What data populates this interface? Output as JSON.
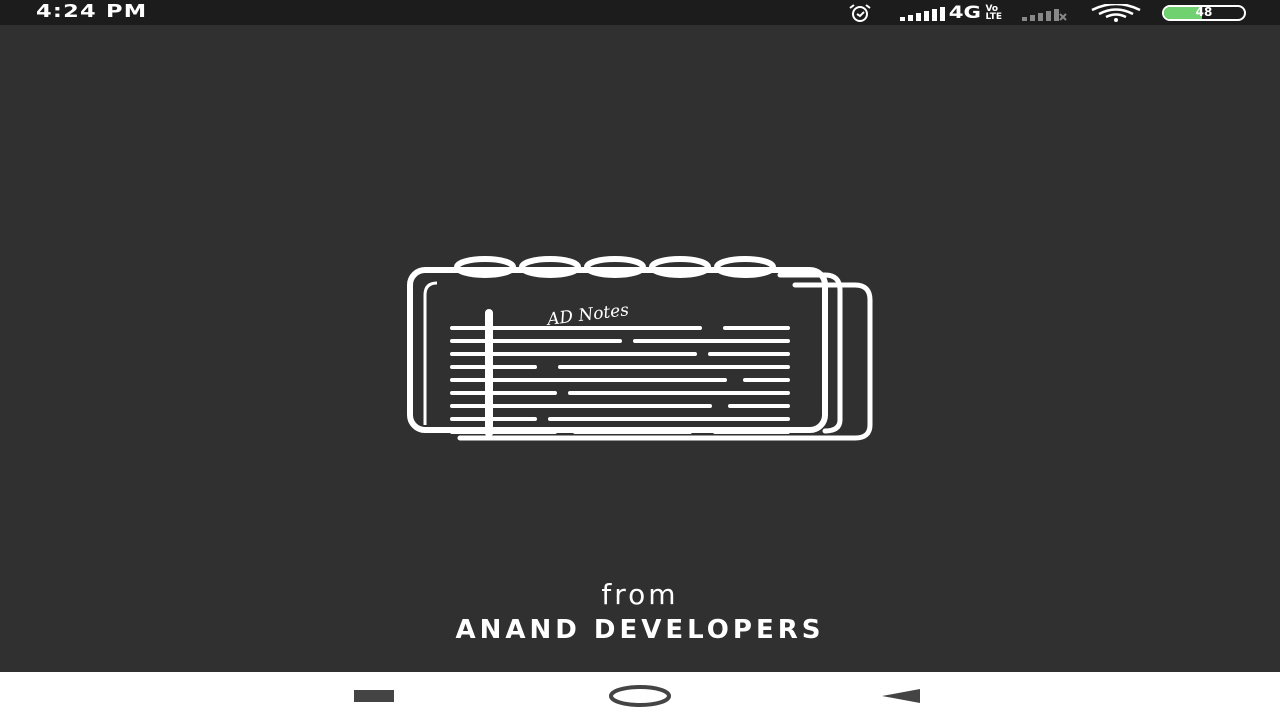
{
  "status_bar": {
    "time": "4:24 PM",
    "network": "4G",
    "volte_top": "Vo",
    "volte_bottom": "LTE",
    "battery": "48",
    "battery_level": 0.48,
    "icons": [
      "alarm-icon",
      "signal-icon",
      "volte-icon",
      "signal-2-icon",
      "wifi-icon",
      "battery-icon"
    ]
  },
  "splash": {
    "logo_text": "AD Notes",
    "from": "from",
    "developer": "ANAND DEVELOPERS"
  },
  "nav_bar": {
    "buttons": [
      "recents-button",
      "home-button",
      "back-button"
    ]
  },
  "colors": {
    "background": "#303030",
    "status_bar": "#1c1c1c",
    "nav_bar": "#ffffff",
    "battery": "#6fd16f",
    "foreground": "#ffffff"
  }
}
